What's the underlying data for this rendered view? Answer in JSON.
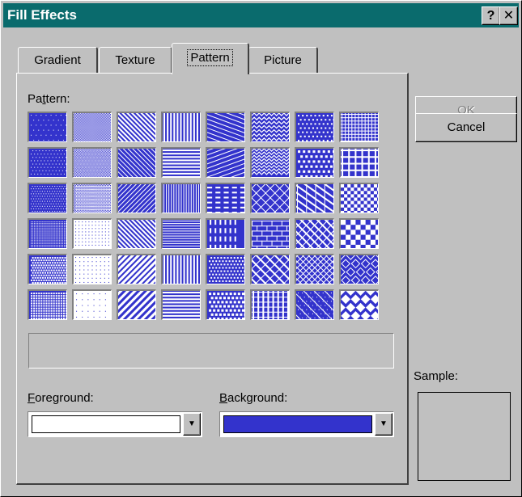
{
  "window": {
    "title": "Fill Effects",
    "help_label": "?",
    "close_label": "✕"
  },
  "tabs": [
    {
      "label": "Gradient",
      "active": false
    },
    {
      "label": "Texture",
      "active": false
    },
    {
      "label": "Pattern",
      "active": true
    },
    {
      "label": "Picture",
      "active": false
    }
  ],
  "pattern_section": {
    "label_pre": "Pa",
    "label_key": "t",
    "label_post": "tern:",
    "description": "",
    "patterns": [
      "pct5",
      "pct50",
      "wide-down-diag",
      "dark-vert",
      "dash-down-diag",
      "small-wave",
      "small-confetti",
      "small-grid",
      "pct10",
      "pct60",
      "light-down-diag",
      "dark-horz",
      "dash-up-diag",
      "wave",
      "large-confetti",
      "large-grid",
      "pct20",
      "pct70",
      "light-up-diag",
      "light-vert",
      "dash-horz",
      "zigzag",
      "shingle",
      "small-checker",
      "pct25",
      "pct75",
      "dark-down-diag",
      "light-horz",
      "dash-vert",
      "brick-horz",
      "weave",
      "large-checker",
      "pct30",
      "pct80",
      "dark-up-diag",
      "narrow-vert",
      "small-bubbles",
      "brick-diag",
      "trellis",
      "outlined-diamond",
      "pct40",
      "pct90",
      "wide-up-diag",
      "narrow-horz",
      "sphere",
      "plaid",
      "divot",
      "solid-diamond"
    ]
  },
  "foreground": {
    "label_key": "F",
    "label_rest": "oreground:",
    "color": "#ffffff",
    "arrow": "▼"
  },
  "background": {
    "label_key": "B",
    "label_rest": "ackground:",
    "color": "#3333cc",
    "arrow": "▼"
  },
  "buttons": {
    "ok": "OK",
    "cancel": "Cancel"
  },
  "sample": {
    "label": "Sample:"
  },
  "colors": {
    "title_bg": "#0a6b6d",
    "pattern_fg": "#ffffff",
    "pattern_bg": "#3333cc",
    "face": "#c0c0c0"
  }
}
